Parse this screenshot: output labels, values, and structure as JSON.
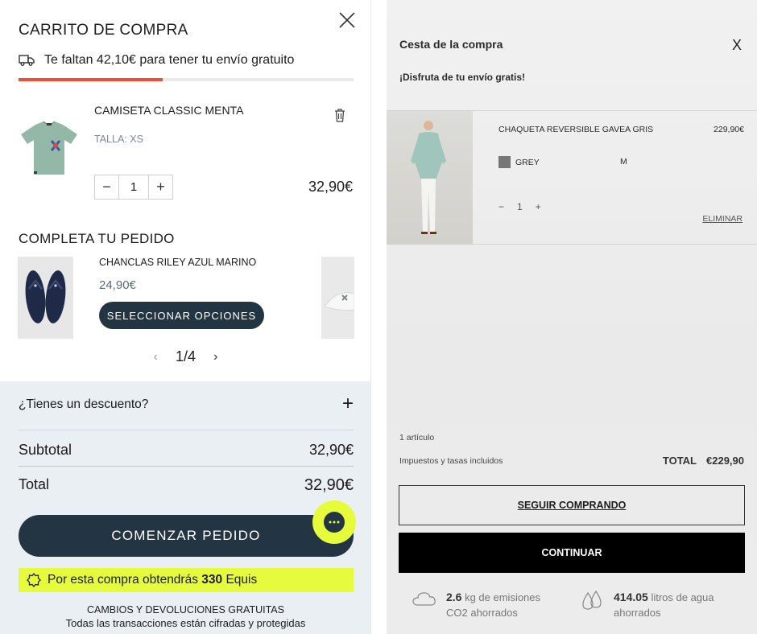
{
  "left_cart": {
    "title": "CARRITO DE COMPRA",
    "shipping_text": "Te faltan 42,10€ para tener tu envío gratuito",
    "shipping_progress_fraction": 0.43,
    "item": {
      "name": "CAMISETA CLASSIC MENTA",
      "size": "TALLA: XS",
      "quantity": "1",
      "price": "32,90€",
      "decrease": "−",
      "increase": "+"
    },
    "complete_title": "COMPLETA TU PEDIDO",
    "recommendation": {
      "name": "CHANCLAS RILEY AZUL MARINO",
      "price": "24,90€",
      "button": "SELECCIONAR OPCIONES"
    },
    "pager": {
      "prev": "‹",
      "current": "1/4",
      "next": "›"
    },
    "summary": {
      "discount_label": "¿Tienes un descuento?",
      "discount_toggle": "+",
      "subtotal_label": "Subtotal",
      "subtotal_value": "32,90€",
      "total_label": "Total",
      "total_value": "32,90€",
      "checkout_button": "COMENZAR PEDIDO",
      "points_prefix": "Por esta compra obtendrás ",
      "points_value": "330",
      "points_suffix": " Equis",
      "footer_line1": "CAMBIOS Y DEVOLUCIONES GRATUITAS",
      "footer_line2": "Todas las transacciones están cifradas y protegidas"
    },
    "colors": {
      "accent": "#f04e34",
      "dark": "#233543",
      "highlight": "#e5fb3c",
      "summary_bg": "#eaeff4"
    }
  },
  "right_cart": {
    "title": "Cesta de la compra",
    "close": "X",
    "subtitle": "¡Disfruta de tu envío gratis!",
    "item": {
      "name": "CHAQUETA REVERSIBLE GAVEA GRIS",
      "price": "229,90€",
      "color": "GREY",
      "size": "M",
      "decrease": "−",
      "quantity": "1",
      "increase": "+",
      "remove": "ELIMINAR"
    },
    "count": "1 artículo",
    "tax_note": "Impuestos y tasas incluidos",
    "total_label": "TOTAL",
    "total_value": "€229,90",
    "continue_shopping": "SEGUIR COMPRANDO",
    "continue": "CONTINUAR",
    "eco": [
      {
        "value": "2.6",
        "text": " kg de emisiones",
        "line2": "CO2 ahorrados",
        "icon": "cloud-icon"
      },
      {
        "value": "414.05",
        "text": " litros de agua",
        "line2": "ahorrados",
        "icon": "water-drops-icon"
      }
    ]
  }
}
